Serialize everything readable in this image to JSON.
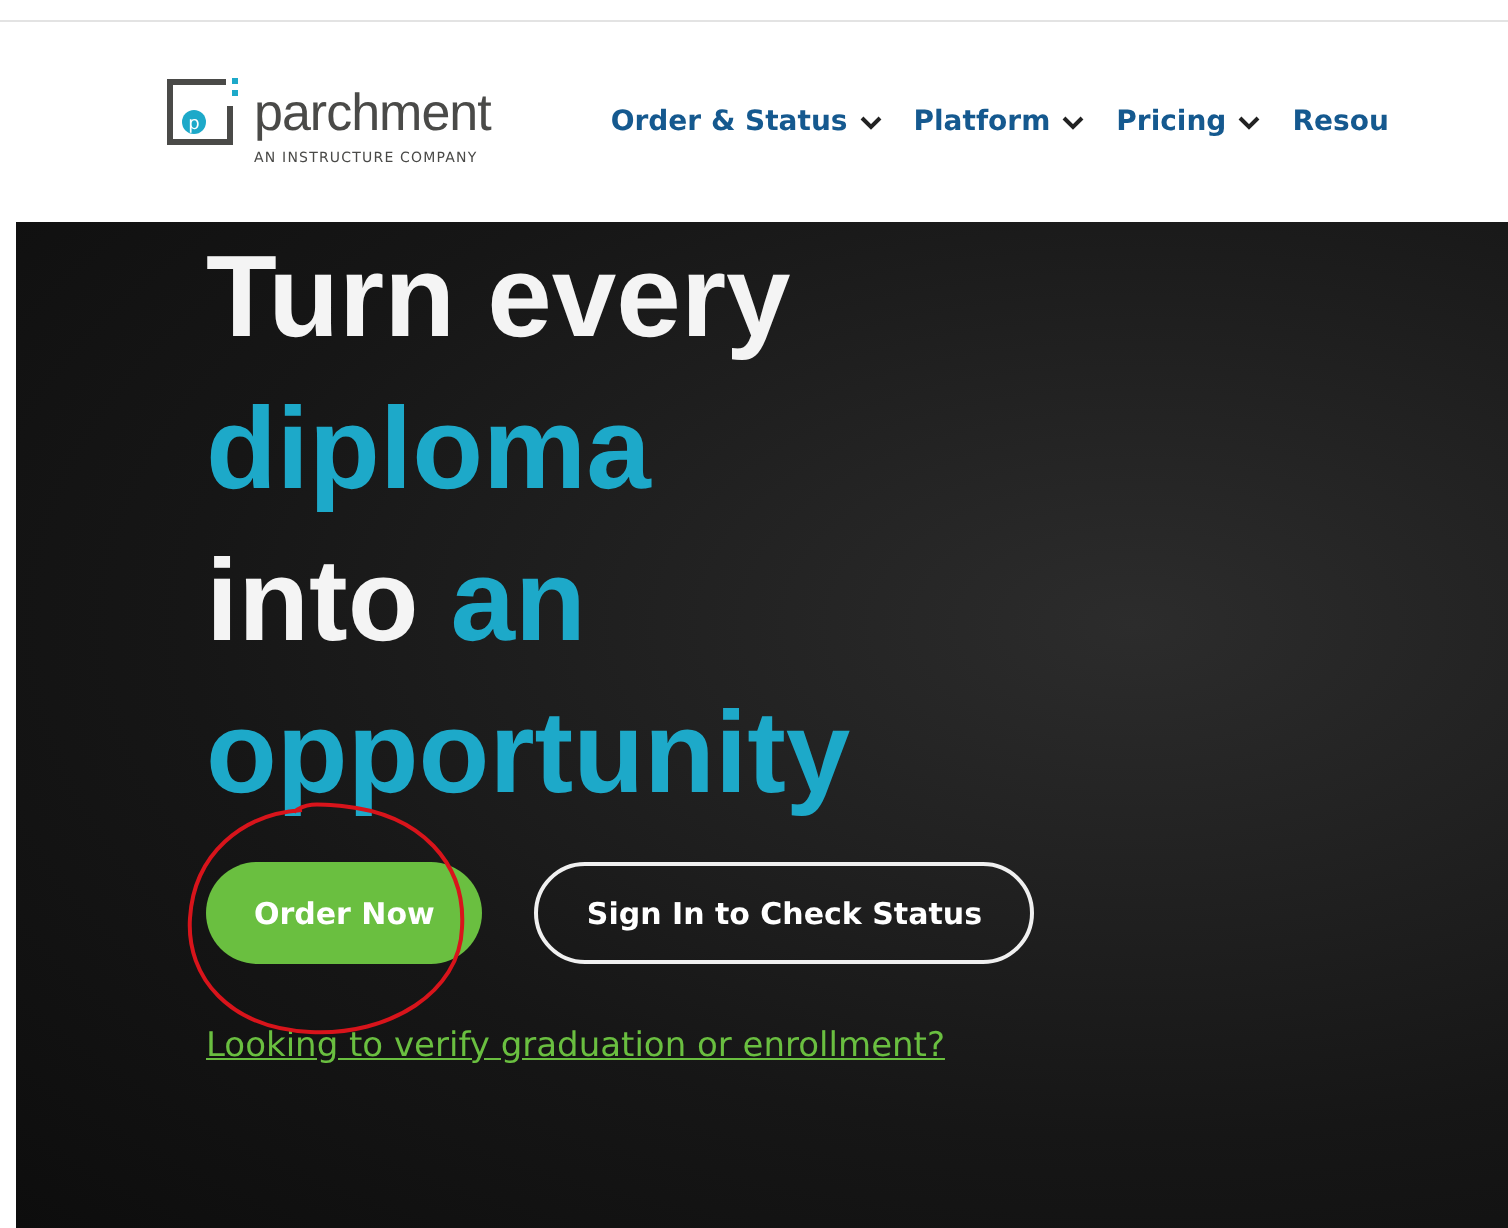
{
  "header": {
    "logo": {
      "wordmark": "parchment",
      "letter": "p",
      "tagline": "AN INSTRUCTURE COMPANY"
    },
    "nav": [
      {
        "label": "Order & Status",
        "caret": true
      },
      {
        "label": "Platform",
        "caret": true
      },
      {
        "label": "Pricing",
        "caret": true
      },
      {
        "label": "Resou",
        "caret": false
      }
    ]
  },
  "hero": {
    "headline": [
      [
        {
          "text": "Turn every",
          "accent": false
        }
      ],
      [
        {
          "text": "diploma",
          "accent": true
        }
      ],
      [
        {
          "text": "into",
          "accent": false
        },
        {
          "text": "an",
          "accent": true
        }
      ],
      [
        {
          "text": "opportunity",
          "accent": true
        }
      ]
    ],
    "buttons": [
      {
        "label": "Order Now",
        "kind": "primary",
        "circled": true
      },
      {
        "label": "Sign In to Check Status",
        "kind": "outline",
        "circled": false
      }
    ],
    "link": "Looking to verify graduation or enrollment?"
  }
}
